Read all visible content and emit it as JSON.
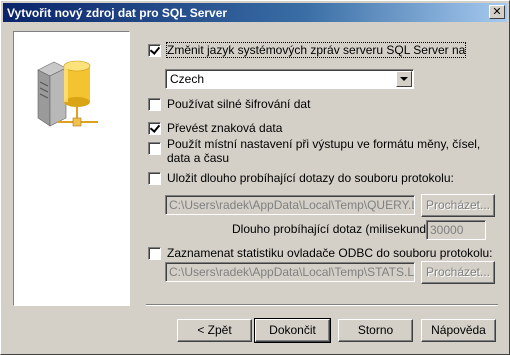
{
  "window": {
    "title": "Vytvořit nový zdroj dat pro SQL Server",
    "close_glyph": "✕"
  },
  "options": {
    "change_language_label": "Změnit jazyk systémových zpráv serveru SQL Server na",
    "change_language_checked": true,
    "language_selected": "Czech",
    "strong_encryption_label": "Používat silné šifrování dat",
    "strong_encryption_checked": false,
    "translate_chars_label": "Převést znaková data",
    "translate_chars_checked": true,
    "regional_settings_label": "Použít místní nastavení při výstupu ve formátu měny, čísel, data a času",
    "regional_settings_checked": false,
    "save_long_queries_label": "Uložit dlouho probíhající dotazy do souboru protokolu:",
    "save_long_queries_checked": false,
    "query_log_path": "C:\\Users\\radek\\AppData\\Local\\Temp\\QUERY.LOG",
    "browse_label": "Procházet...",
    "long_query_time_label": "Dlouho probíhající dotaz (milisekundy):",
    "long_query_time_value": "30000",
    "log_stats_label": "Zaznamenat statistiku ovladače ODBC do souboru protokolu:",
    "log_stats_checked": false,
    "stats_log_path": "C:\\Users\\radek\\AppData\\Local\\Temp\\STATS.LOG"
  },
  "footer": {
    "back_label": "< Zpět",
    "finish_label": "Dokončit",
    "cancel_label": "Storno",
    "help_label": "Nápověda"
  },
  "icons": {
    "wizard_image": "server-database-icon"
  }
}
